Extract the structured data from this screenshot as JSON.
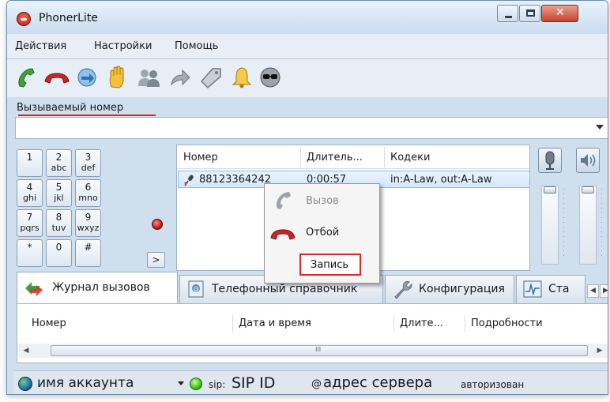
{
  "window": {
    "title": "PhonerLite"
  },
  "menu": {
    "items": [
      "Действия",
      "Настройки",
      "Помощь"
    ]
  },
  "toolbar": {
    "buttons": [
      "call-icon",
      "hangup-icon",
      "transfer-icon",
      "hold-icon",
      "conference-icon",
      "forward-icon",
      "tag-icon",
      "bell-icon",
      "anonymous-icon"
    ]
  },
  "callee": {
    "label": "Вызываемый номер",
    "value": ""
  },
  "keypad": {
    "keys": [
      {
        "digit": "1",
        "letters": ""
      },
      {
        "digit": "2",
        "letters": "abc"
      },
      {
        "digit": "3",
        "letters": "def"
      },
      {
        "digit": "4",
        "letters": "ghi"
      },
      {
        "digit": "5",
        "letters": "jkl"
      },
      {
        "digit": "6",
        "letters": "mno"
      },
      {
        "digit": "7",
        "letters": "pqrs"
      },
      {
        "digit": "8",
        "letters": "tuv"
      },
      {
        "digit": "9",
        "letters": "wxyz"
      },
      {
        "digit": "*",
        "letters": ""
      },
      {
        "digit": "0",
        "letters": ""
      },
      {
        "digit": "#",
        "letters": ""
      }
    ],
    "more_label": ">"
  },
  "calls": {
    "columns": [
      "Номер",
      "Длитель...",
      "Кодеки"
    ],
    "rows": [
      {
        "number": "88123364242",
        "duration": "0:00:57",
        "codecs": "in:A-Law, out:A-Law"
      }
    ]
  },
  "context_menu": {
    "items": [
      {
        "label": "Вызов",
        "enabled": false
      },
      {
        "label": "Отбой",
        "enabled": true
      },
      {
        "label": "Запись",
        "enabled": true
      }
    ]
  },
  "tabs": {
    "items": [
      "Журнал вызовов",
      "Телефонный справочник",
      "Конфигурация",
      "Ста"
    ],
    "active": 0
  },
  "log": {
    "columns": [
      "Номер",
      "Дата и время",
      "Длите...",
      "Подробности"
    ],
    "scroll_grip": "III"
  },
  "status": {
    "account": "имя аккаунта",
    "sip_prefix": "sip:",
    "sip_id": "SIP ID",
    "at": "@",
    "server": "адрес сервера",
    "state": "авторизован"
  },
  "colors": {
    "accent_red": "#e0231b",
    "selection": "#d4e7fb"
  }
}
